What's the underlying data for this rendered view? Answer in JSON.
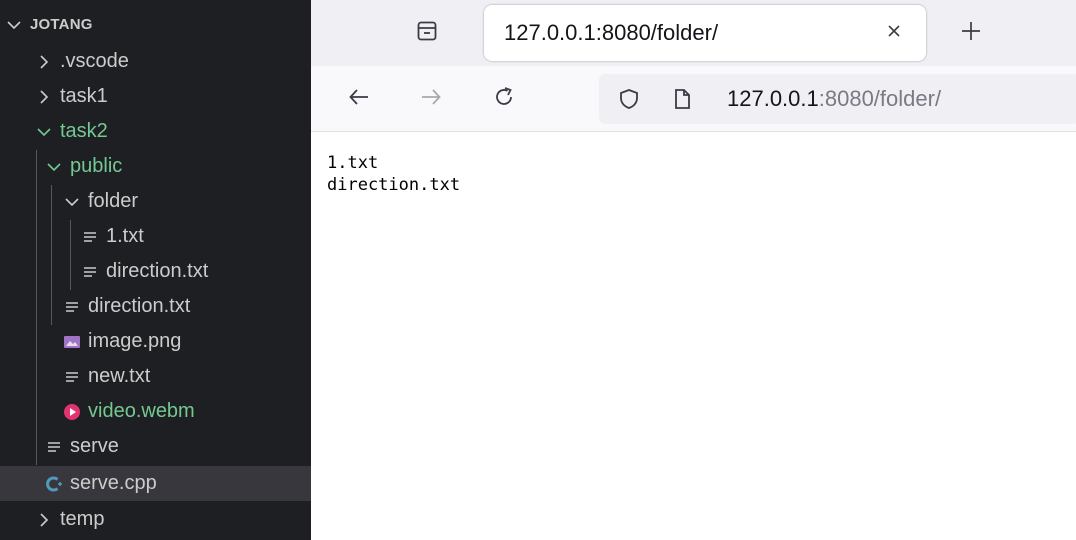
{
  "explorer": {
    "root": "JOTANG",
    "items": {
      "vscode": ".vscode",
      "task1": "task1",
      "task2": "task2",
      "public": "public",
      "folder": "folder",
      "folder_file1": "1.txt",
      "folder_file2": "direction.txt",
      "public_direction": "direction.txt",
      "image": "image.png",
      "new": "new.txt",
      "video": "video.webm",
      "serve": "serve",
      "serve_cpp": "serve.cpp",
      "temp": "temp"
    }
  },
  "browser": {
    "tab_title": "127.0.0.1:8080/folder/",
    "url_host": "127.0.0.1",
    "url_rest": ":8080/folder/",
    "listing": [
      "1.txt",
      "direction.txt"
    ]
  },
  "colors": {
    "sidebar_bg": "#1e1f22",
    "selected_row": "#37373d",
    "git_untracked_green": "#73c991",
    "image_icon_purple": "#a074c4",
    "video_icon_pink": "#e2336f",
    "cpp_icon_blue": "#519aba"
  }
}
